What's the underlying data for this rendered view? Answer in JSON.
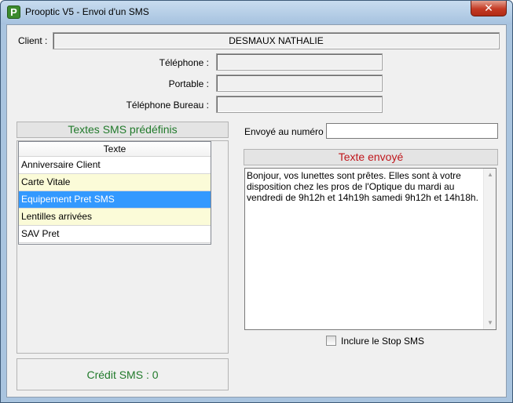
{
  "window": {
    "title": "Prooptic V5 - Envoi d'un SMS",
    "app_icon_glyph": "P",
    "close_glyph": "✕"
  },
  "client": {
    "label": "Client :",
    "name": "DESMAUX NATHALIE"
  },
  "phones": {
    "telephone_label": "Téléphone :",
    "telephone_value": "",
    "portable_label": "Portable :",
    "portable_value": "",
    "bureau_label": "Téléphone Bureau :",
    "bureau_value": ""
  },
  "predefined": {
    "title": "Textes SMS prédéfinis",
    "column_header": "Texte",
    "items": [
      {
        "label": "Anniversaire Client",
        "state": "normal"
      },
      {
        "label": "Carte Vitale",
        "state": "alt"
      },
      {
        "label": "Equipement Pret SMS",
        "state": "selected"
      },
      {
        "label": "Lentilles arrivées",
        "state": "alt"
      },
      {
        "label": "SAV Pret",
        "state": "normal"
      }
    ]
  },
  "credit": {
    "text": "Crédit SMS : 0"
  },
  "send": {
    "number_label": "Envoyé au numéro :",
    "number_value": "",
    "sent_title": "Texte envoyé",
    "message": "Bonjour, vos lunettes sont prêtes. Elles sont à votre disposition chez les pros de l'Optique du mardi au vendredi de 9h12h et 14h19h samedi 9h12h et 14h18h.",
    "stop_label": "Inclure le Stop SMS",
    "stop_checked": false
  },
  "colors": {
    "accent_green": "#217a2b",
    "accent_red": "#c0171c",
    "selection_blue": "#3399ff",
    "alt_row_yellow": "#fbfbd8"
  },
  "icons": {
    "app": "prooptic-app-icon",
    "close": "close-icon",
    "scroll_up": "chevron-up-icon",
    "scroll_down": "chevron-down-icon"
  }
}
